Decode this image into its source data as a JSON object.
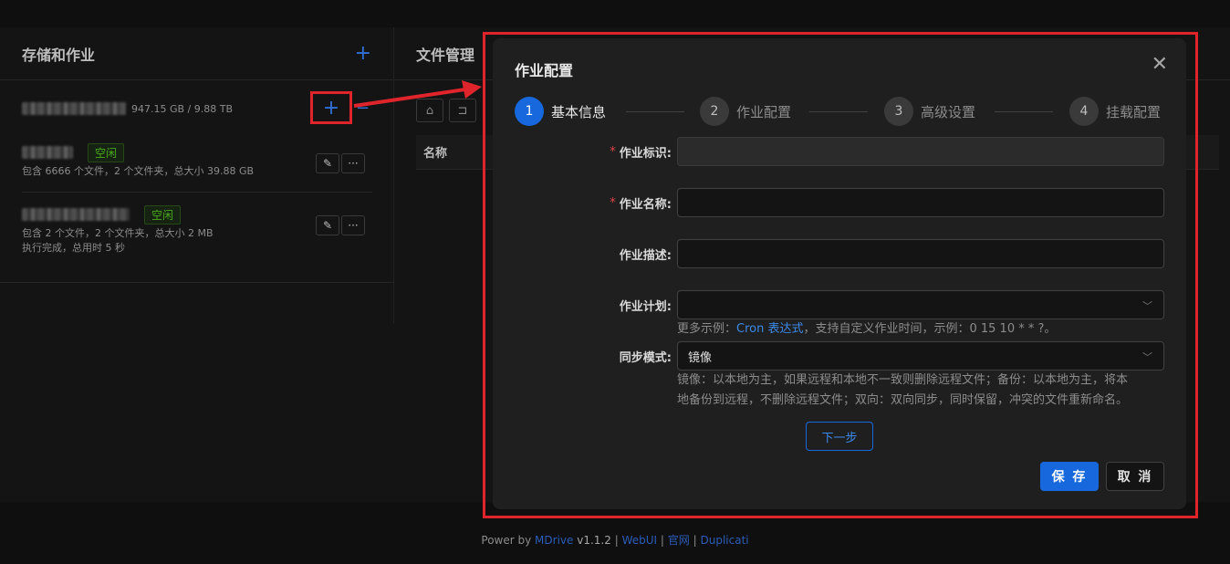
{
  "left_panel": {
    "title": "存储和作业",
    "storage": {
      "size": "947.15 GB / 9.88 TB"
    },
    "jobs": [
      {
        "status": "空闲",
        "desc": [
          "包含 6666 个文件，2 个文件夹，总大小 39.88 GB"
        ]
      },
      {
        "status": "空闲",
        "desc": [
          "包含 2 个文件，2 个文件夹，总大小 2 MB",
          "执行完成，总用时 5 秒"
        ]
      }
    ]
  },
  "right_panel": {
    "title": "文件管理",
    "column_name": "名称"
  },
  "modal": {
    "title": "作业配置",
    "steps": [
      {
        "num": "1",
        "label": "基本信息"
      },
      {
        "num": "2",
        "label": "作业配置"
      },
      {
        "num": "3",
        "label": "高级设置"
      },
      {
        "num": "4",
        "label": "挂载配置"
      }
    ],
    "fields": {
      "job_id": {
        "label": "作业标识:",
        "value": ""
      },
      "job_name": {
        "label": "作业名称:",
        "value": ""
      },
      "job_desc": {
        "label": "作业描述:",
        "value": ""
      },
      "job_schedule": {
        "label": "作业计划:",
        "value": ""
      },
      "schedule_help_prefix": "更多示例：",
      "schedule_help_link": "Cron 表达式",
      "schedule_help_suffix": "，支持自定义作业时间，示例：0 15 10 * * ?。",
      "sync_mode": {
        "label": "同步模式:",
        "value": "镜像"
      },
      "sync_help": [
        "镜像：以本地为主，如果远程和本地不一致则删除远程文件；备份：以本地为主，将本",
        "地备份到远程，不删除远程文件；双向：双向同步，同时保留，冲突的文件重新命名。"
      ]
    },
    "next_label": "下一步",
    "save_label": "保 存",
    "cancel_label": "取 消"
  },
  "footer": {
    "power_by": "Power by",
    "brand": "MDrive",
    "version": "v1.1.2",
    "sep": "|",
    "webui": "WebUI",
    "official": "官网",
    "duplicati": "Duplicati"
  },
  "colors": {
    "accent": "#1668dc",
    "highlight_red": "#e0242b",
    "idle_green": "#49aa19"
  }
}
